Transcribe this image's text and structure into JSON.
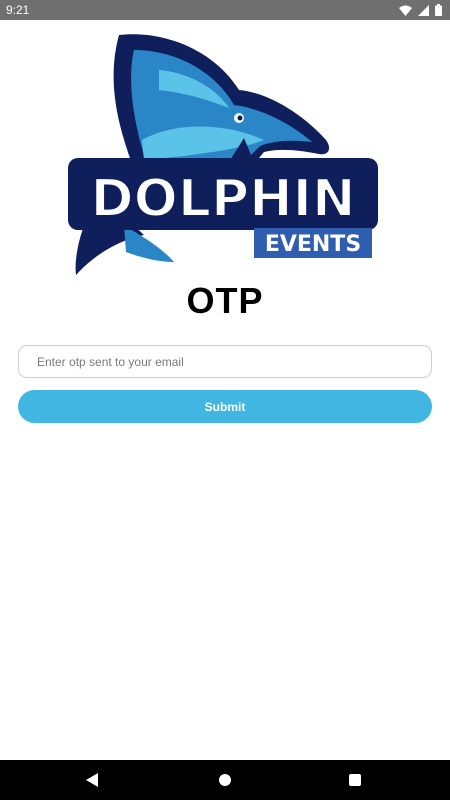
{
  "status_bar": {
    "time": "9:21",
    "icons": [
      "wifi-icon",
      "cell-signal-icon",
      "battery-icon"
    ],
    "background": "#6f6f6f"
  },
  "logo": {
    "brand_name": "DOLPHIN",
    "brand_sub": "EVENTS",
    "colors": {
      "navy": "#0f1f5c",
      "blue": "#2b86c7",
      "light_blue": "#5cc3e8",
      "events_banner": "#2f5db0"
    }
  },
  "page": {
    "title": "OTP"
  },
  "form": {
    "otp_placeholder": "Enter otp sent to your email",
    "otp_value": "",
    "submit_label": "Submit",
    "accent": "#42b6e2"
  },
  "nav_bar": {
    "buttons": [
      "back-icon",
      "home-icon",
      "recents-icon"
    ]
  }
}
